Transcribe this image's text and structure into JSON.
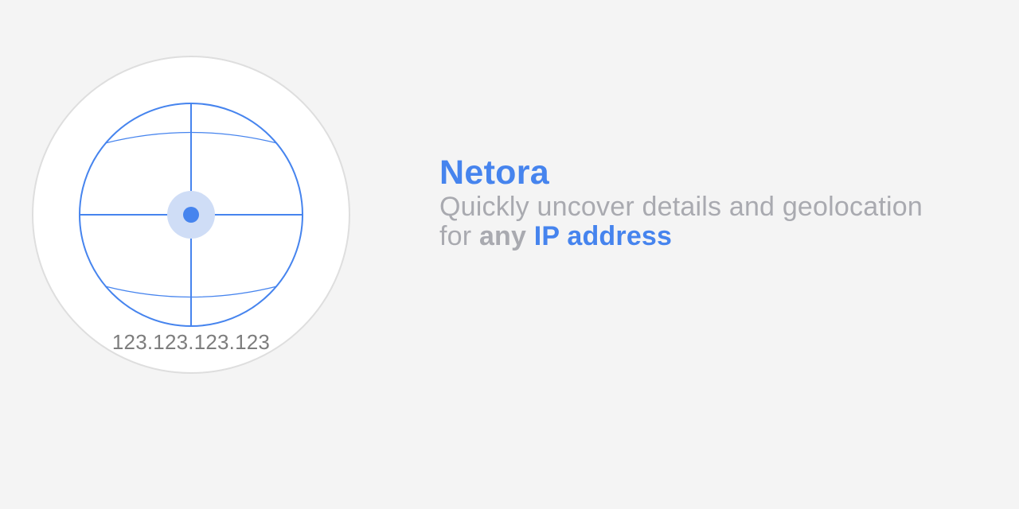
{
  "logo": {
    "icon": "globe-crosshair-icon",
    "ip_address": "123.123.123.123"
  },
  "headline": {
    "brand": "Netora",
    "tagline_line1": "Quickly uncover details and geolocation",
    "tagline_line2_prefix": "for ",
    "tagline_line2_strong": "any",
    "tagline_line2_space": " ",
    "tagline_line2_highlight": "IP address"
  },
  "colors": {
    "background": "#f4f4f4",
    "accent": "#4684ee",
    "tagline": "#a9aab0",
    "ip_text": "#7d7d7d",
    "disc": "#ffffff",
    "disc_border": "#dedede"
  }
}
